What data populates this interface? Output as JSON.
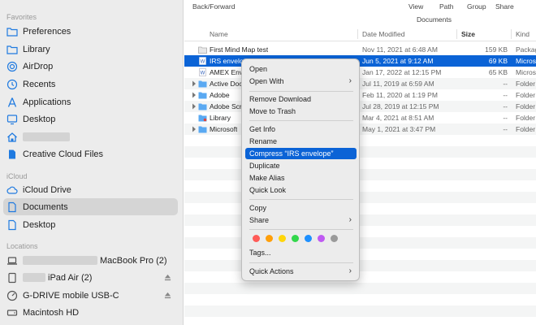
{
  "sidebar": {
    "favorites_title": "Favorites",
    "favorites": [
      {
        "label": "Preferences",
        "icon": "folder-icon"
      },
      {
        "label": "Library",
        "icon": "folder-icon"
      },
      {
        "label": "AirDrop",
        "icon": "airdrop-icon"
      },
      {
        "label": "Recents",
        "icon": "clock-icon"
      },
      {
        "label": "Applications",
        "icon": "applications-icon"
      },
      {
        "label": "Desktop",
        "icon": "desktop-icon"
      },
      {
        "label": "",
        "icon": "home-icon"
      },
      {
        "label": "Creative Cloud Files",
        "icon": "document-icon"
      }
    ],
    "icloud_title": "iCloud",
    "icloud": [
      {
        "label": "iCloud Drive",
        "icon": "cloud-icon"
      },
      {
        "label": "Documents",
        "icon": "document-icon"
      },
      {
        "label": "Desktop",
        "icon": "document-icon"
      }
    ],
    "locations_title": "Locations",
    "locations": [
      {
        "label": "MacBook Pro (2)",
        "icon": "laptop-icon"
      },
      {
        "label": "iPad Air (2)",
        "icon": "ipad-icon"
      },
      {
        "label": "G-DRIVE mobile USB-C",
        "icon": "disk-icon"
      },
      {
        "label": "Macintosh HD",
        "icon": "disk-icon"
      }
    ]
  },
  "toolbar": {
    "back_forward": "Back/Forward",
    "view": "View",
    "path": "Path",
    "group": "Group",
    "share": "Share",
    "window_title": "Documents"
  },
  "columns": {
    "name": "Name",
    "date": "Date Modified",
    "size": "Size",
    "kind": "Kind"
  },
  "files": [
    {
      "name": "First Mind Map test",
      "date": "Nov 11, 2021 at 6:48 AM",
      "size": "159 KB",
      "kind": "Package"
    },
    {
      "name": "IRS envelope",
      "date": "Jun 5, 2021 at 9:12 AM",
      "size": "69 KB",
      "kind": "Microsoft"
    },
    {
      "name": "AMEX Env",
      "date": "Jan 17, 2022 at 12:15 PM",
      "size": "65 KB",
      "kind": "Microsoft"
    },
    {
      "name": "Active Doc",
      "date": "Jul 11, 2019 at 6:59 AM",
      "size": "--",
      "kind": "Folder"
    },
    {
      "name": "Adobe",
      "date": "Feb 11, 2020 at 1:19 PM",
      "size": "--",
      "kind": "Folder"
    },
    {
      "name": "Adobe Scr",
      "date": "Jul 28, 2019 at 12:15 PM",
      "size": "--",
      "kind": "Folder"
    },
    {
      "name": "Library",
      "date": "Mar 4, 2021 at 8:51 AM",
      "size": "--",
      "kind": "Folder"
    },
    {
      "name": "Microsoft",
      "date": "May 1, 2021 at 3:47 PM",
      "size": "--",
      "kind": "Folder"
    }
  ],
  "context_menu": {
    "open": "Open",
    "open_with": "Open With",
    "remove_download": "Remove Download",
    "move_to_trash": "Move to Trash",
    "get_info": "Get Info",
    "rename": "Rename",
    "compress": "Compress “IRS envelope”",
    "duplicate": "Duplicate",
    "make_alias": "Make Alias",
    "quick_look": "Quick Look",
    "copy": "Copy",
    "share": "Share",
    "tags": "Tags...",
    "quick_actions": "Quick Actions",
    "tag_colors": [
      "#ff5b57",
      "#ff9f0a",
      "#ffd60a",
      "#32d74b",
      "#1e90ff",
      "#bf5af2",
      "#9a9a9a"
    ]
  },
  "colors": {
    "selection": "#0b63d6",
    "accent_icon": "#1f7ae0"
  }
}
